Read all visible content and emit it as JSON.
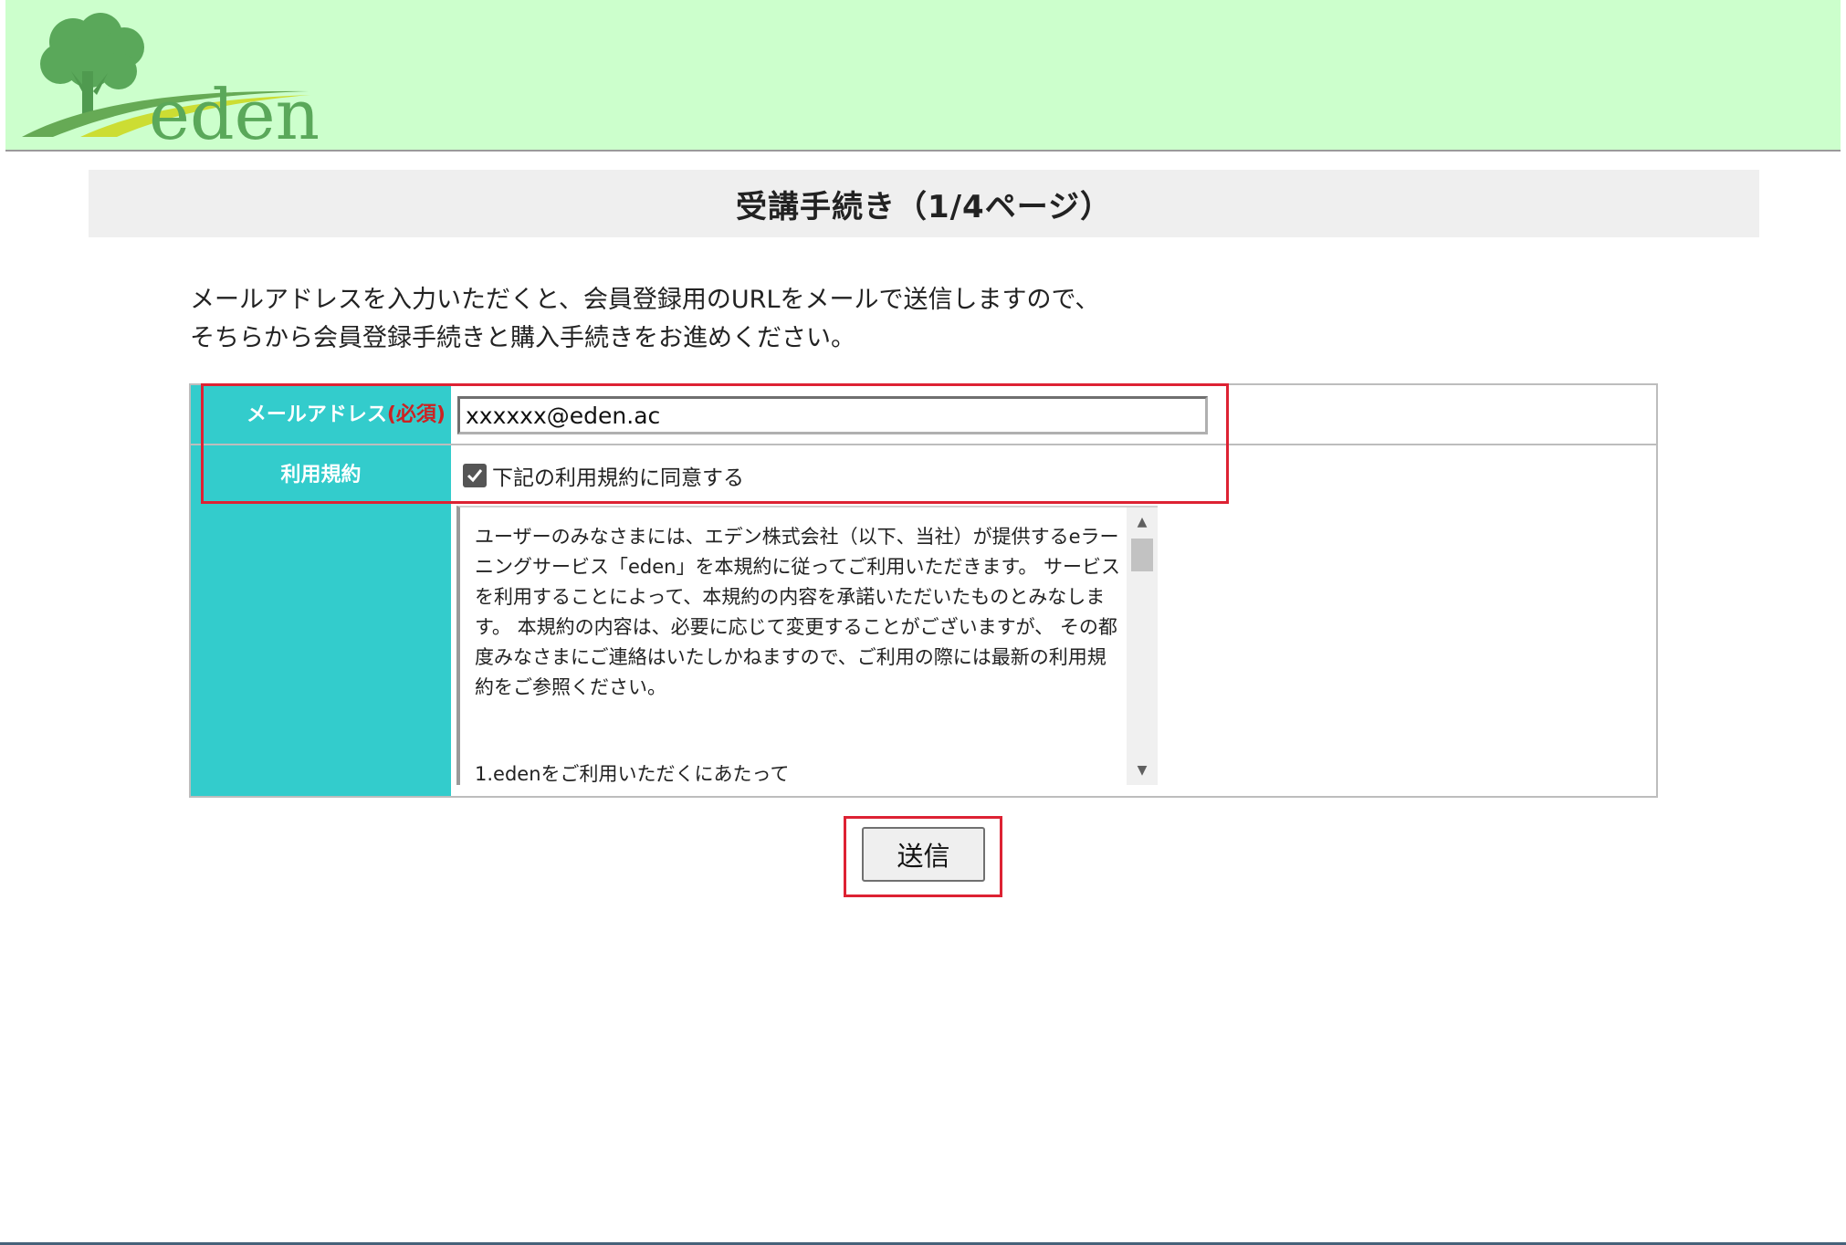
{
  "header": {
    "logo_text": "eden",
    "bg_color": "#ccffcc"
  },
  "title": "受講手続き（1/4ページ）",
  "intro": {
    "line1": "メールアドレスを入力いただくと、会員登録用のURLをメールで送信しますので、",
    "line2": "そちらから会員登録手続きと購入手続きをお進めください。"
  },
  "form": {
    "email_label": "メールアドレス",
    "required_tag": "(必須)",
    "email_value": "xxxxxx@eden.ac",
    "terms_label": "利用規約",
    "agree_label": "下記の利用規約に同意する",
    "agree_checked": true,
    "terms_body": "ユーザーのみなさまには、エデン株式会社（以下、当社）が提供するeラーニングサービス「eden」を本規約に従ってご利用いただきます。 サービスを利用することによって、本規約の内容を承諾いただいたものとみなします。 本規約の内容は、必要に応じて変更することがございますが、 その都度みなさまにご連絡はいたしかねますので、ご利用の際には最新の利用規約をご参照ください。",
    "terms_section_1": "1.edenをご利用いただくにあたって",
    "label_bg_color": "#33cccc"
  },
  "submit_label": "送信",
  "highlight_color": "#dd2233"
}
